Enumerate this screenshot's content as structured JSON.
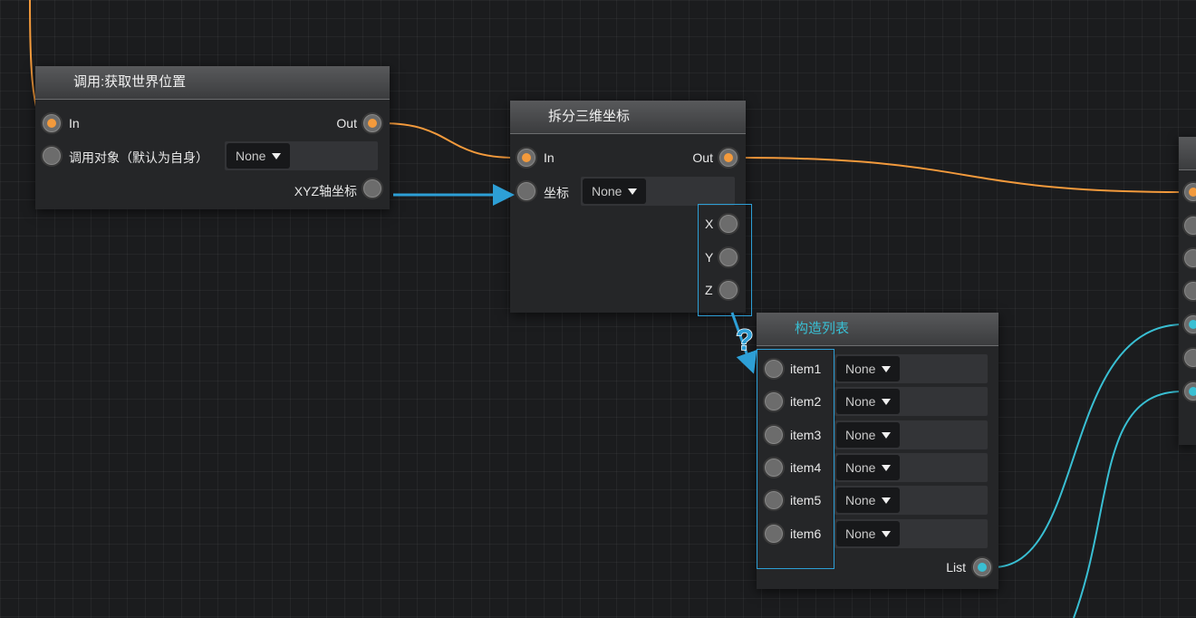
{
  "colors": {
    "exec_wire": "#f39a3c",
    "list_wire": "#39bfd3",
    "hint_arrow": "#2d9fd6"
  },
  "nodes": {
    "get_world_pos": {
      "title": "调用:获取世界位置",
      "in_label": "In",
      "out_label": "Out",
      "target_label": "调用对象（默认为自身）",
      "target_value": "None",
      "output_label": "XYZ轴坐标"
    },
    "split_vector": {
      "title": "拆分三维坐标",
      "in_label": "In",
      "out_label": "Out",
      "coord_label": "坐标",
      "coord_value": "None",
      "x_label": "X",
      "y_label": "Y",
      "z_label": "Z"
    },
    "make_list": {
      "title": "构造列表",
      "items": [
        {
          "label": "item1",
          "value": "None"
        },
        {
          "label": "item2",
          "value": "None"
        },
        {
          "label": "item3",
          "value": "None"
        },
        {
          "label": "item4",
          "value": "None"
        },
        {
          "label": "item5",
          "value": "None"
        },
        {
          "label": "item6",
          "value": "None"
        }
      ],
      "output_label": "List"
    }
  },
  "hint": {
    "glyph": "?"
  }
}
